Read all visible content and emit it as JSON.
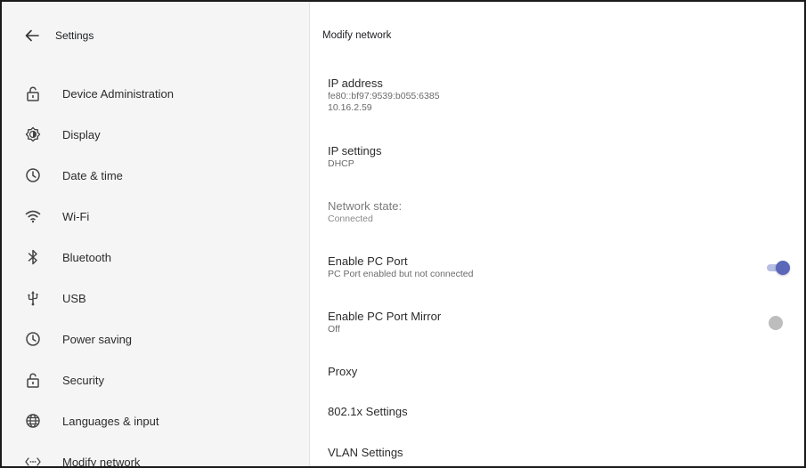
{
  "nav": {
    "title": "Settings",
    "items": [
      {
        "label": "Device Administration",
        "icon": "lock-open-icon"
      },
      {
        "label": "Display",
        "icon": "brightness-icon"
      },
      {
        "label": "Date & time",
        "icon": "clock-icon"
      },
      {
        "label": "Wi-Fi",
        "icon": "wifi-icon"
      },
      {
        "label": "Bluetooth",
        "icon": "bluetooth-icon"
      },
      {
        "label": "USB",
        "icon": "usb-icon"
      },
      {
        "label": "Power saving",
        "icon": "clock-icon"
      },
      {
        "label": "Security",
        "icon": "lock-open-icon"
      },
      {
        "label": "Languages & input",
        "icon": "globe-icon"
      },
      {
        "label": "Modify network",
        "icon": "network-arrows-icon"
      }
    ]
  },
  "detail": {
    "title": "Modify network",
    "ip_address": {
      "title": "IP address",
      "ipv6": "fe80::bf97:9539:b055:6385",
      "ipv4": "10.16.2.59"
    },
    "ip_settings": {
      "title": "IP settings",
      "value": "DHCP"
    },
    "network_state": {
      "title": "Network state:",
      "value": "Connected"
    },
    "pc_port": {
      "title": "Enable PC Port",
      "summary": "PC Port enabled but not connected",
      "enabled": true
    },
    "pc_port_mirror": {
      "title": "Enable PC Port Mirror",
      "summary": "Off",
      "enabled": false
    },
    "proxy": {
      "title": "Proxy"
    },
    "dot1x": {
      "title": "802.1x Settings"
    },
    "vlan": {
      "title": "VLAN Settings"
    }
  },
  "colors": {
    "accent": "#5b67b8",
    "accent_track": "#b7bee3",
    "nav_background": "#f5f5f5",
    "switch_off": "#bdbdbd"
  }
}
